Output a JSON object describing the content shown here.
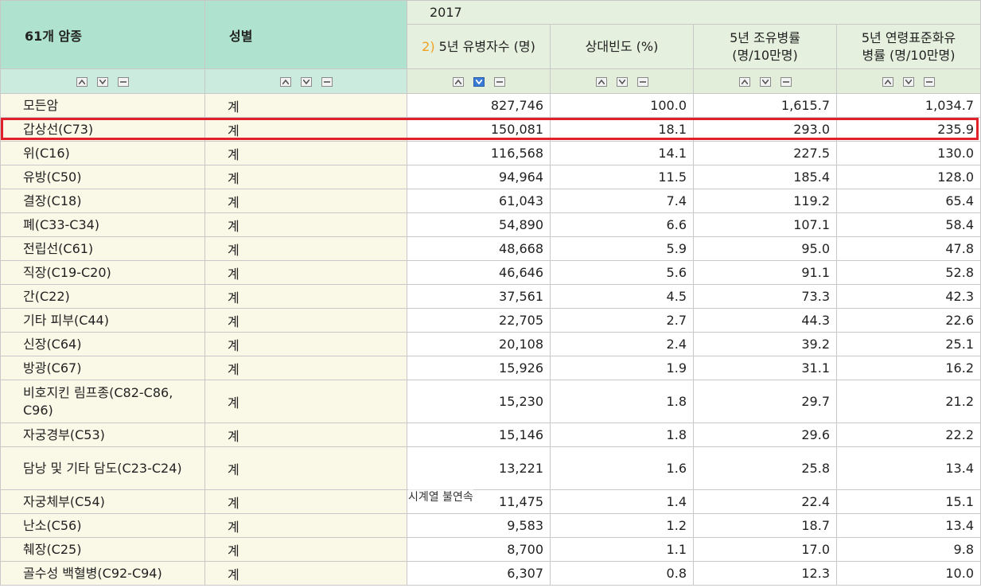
{
  "header": {
    "col_cancer": "61개 암종",
    "col_gender": "성별",
    "year": "2017",
    "note_marker": "2)",
    "col_prevalence": "5년 유병자수 (명)",
    "col_relative": "상대빈도 (%)",
    "col_crude_line1": "5년 조유병률",
    "col_crude_line2": "(명/10만명)",
    "col_age_line1": "5년 연령표준화유",
    "col_age_line2": "병률 (명/10만명)"
  },
  "rows": [
    {
      "cancer": "모든암",
      "gender": "계",
      "prevalence": "827,746",
      "relative": "100.0",
      "crude": "1,615.7",
      "age_std": "1,034.7"
    },
    {
      "cancer": "갑상선(C73)",
      "gender": "계",
      "prevalence": "150,081",
      "relative": "18.1",
      "crude": "293.0",
      "age_std": "235.9"
    },
    {
      "cancer": "위(C16)",
      "gender": "계",
      "prevalence": "116,568",
      "relative": "14.1",
      "crude": "227.5",
      "age_std": "130.0"
    },
    {
      "cancer": "유방(C50)",
      "gender": "계",
      "prevalence": "94,964",
      "relative": "11.5",
      "crude": "185.4",
      "age_std": "128.0"
    },
    {
      "cancer": "결장(C18)",
      "gender": "계",
      "prevalence": "61,043",
      "relative": "7.4",
      "crude": "119.2",
      "age_std": "65.4"
    },
    {
      "cancer": "폐(C33-C34)",
      "gender": "계",
      "prevalence": "54,890",
      "relative": "6.6",
      "crude": "107.1",
      "age_std": "58.4"
    },
    {
      "cancer": "전립선(C61)",
      "gender": "계",
      "prevalence": "48,668",
      "relative": "5.9",
      "crude": "95.0",
      "age_std": "47.8"
    },
    {
      "cancer": "직장(C19-C20)",
      "gender": "계",
      "prevalence": "46,646",
      "relative": "5.6",
      "crude": "91.1",
      "age_std": "52.8"
    },
    {
      "cancer": "간(C22)",
      "gender": "계",
      "prevalence": "37,561",
      "relative": "4.5",
      "crude": "73.3",
      "age_std": "42.3"
    },
    {
      "cancer": "기타 피부(C44)",
      "gender": "계",
      "prevalence": "22,705",
      "relative": "2.7",
      "crude": "44.3",
      "age_std": "22.6"
    },
    {
      "cancer": "신장(C64)",
      "gender": "계",
      "prevalence": "20,108",
      "relative": "2.4",
      "crude": "39.2",
      "age_std": "25.1"
    },
    {
      "cancer": "방광(C67)",
      "gender": "계",
      "prevalence": "15,926",
      "relative": "1.9",
      "crude": "31.1",
      "age_std": "16.2"
    },
    {
      "cancer": "비호지킨 림프종(C82-C86, C96)",
      "gender": "계",
      "prevalence": "15,230",
      "relative": "1.8",
      "crude": "29.7",
      "age_std": "21.2"
    },
    {
      "cancer": "자궁경부(C53)",
      "gender": "계",
      "prevalence": "15,146",
      "relative": "1.8",
      "crude": "29.6",
      "age_std": "22.2"
    },
    {
      "cancer": "담낭 및 기타 담도(C23-C24)",
      "gender": "계",
      "prevalence": "13,221",
      "relative": "1.6",
      "crude": "25.8",
      "age_std": "13.4"
    },
    {
      "cancer": "자궁체부(C54)",
      "gender": "계",
      "prevalence": "11,475",
      "relative": "1.4",
      "crude": "22.4",
      "age_std": "15.1"
    },
    {
      "cancer": "난소(C56)",
      "gender": "계",
      "prevalence": "9,583",
      "relative": "1.2",
      "crude": "18.7",
      "age_std": "13.4"
    },
    {
      "cancer": "췌장(C25)",
      "gender": "계",
      "prevalence": "8,700",
      "relative": "1.1",
      "crude": "17.0",
      "age_std": "9.8"
    },
    {
      "cancer": "골수성 백혈병(C92-C94)",
      "gender": "계",
      "prevalence": "6,307",
      "relative": "0.8",
      "crude": "12.3",
      "age_std": "10.0"
    }
  ],
  "tooltip": "시계열 불연속",
  "colors": {
    "highlight": "#e0202a",
    "header_left": "#b0e3cf",
    "header_right": "#e6f0de",
    "row_label": "#faf8e6"
  }
}
